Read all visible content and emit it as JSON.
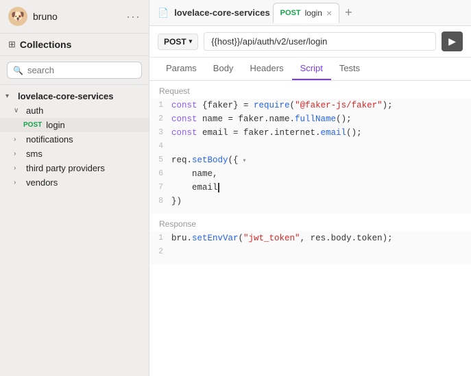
{
  "app": {
    "name": "bruno",
    "icon": "🐶",
    "more_label": "···"
  },
  "sidebar": {
    "collections_label": "Collections",
    "search_placeholder": "search",
    "tree": [
      {
        "id": "lovelace-core-services",
        "label": "lovelace-core-services",
        "level": 0,
        "chevron": "▾",
        "type": "root"
      },
      {
        "id": "auth",
        "label": "auth",
        "level": 1,
        "chevron": "∨",
        "type": "folder"
      },
      {
        "id": "post-login",
        "label": "login",
        "level": 2,
        "method": "POST",
        "type": "request",
        "active": true
      },
      {
        "id": "notifications",
        "label": "notifications",
        "level": 1,
        "chevron": "›",
        "type": "folder"
      },
      {
        "id": "sms",
        "label": "sms",
        "level": 1,
        "chevron": "›",
        "type": "folder"
      },
      {
        "id": "third-party-providers",
        "label": "third party providers",
        "level": 1,
        "chevron": "›",
        "type": "folder"
      },
      {
        "id": "vendors",
        "label": "vendors",
        "level": 1,
        "chevron": "›",
        "type": "folder"
      }
    ]
  },
  "main": {
    "window_title": "lovelace-core-services",
    "tab": {
      "method": "POST",
      "name": "login",
      "close": "×"
    },
    "add_tab": "+",
    "url": {
      "method": "POST",
      "template": "{{host}}",
      "path": "/api/auth/v2/user/login",
      "send_icon": "▶"
    },
    "nav_tabs": [
      "Params",
      "Body",
      "Headers",
      "Script",
      "Tests"
    ],
    "active_nav_tab": "Script",
    "request_label": "Request",
    "response_label": "Response",
    "request_code": [
      {
        "line": 1,
        "tokens": [
          {
            "t": "kw",
            "v": "const"
          },
          {
            "t": "var",
            "v": " {faker} = "
          },
          {
            "t": "fn",
            "v": "require"
          },
          {
            "t": "var",
            "v": "("
          },
          {
            "t": "str",
            "v": "\"@faker-js/faker\""
          },
          {
            "t": "var",
            "v": ");"
          }
        ]
      },
      {
        "line": 2,
        "tokens": [
          {
            "t": "kw",
            "v": "const"
          },
          {
            "t": "var",
            "v": " name = faker.name."
          },
          {
            "t": "fn",
            "v": "fullName"
          },
          {
            "t": "var",
            "v": "();"
          }
        ]
      },
      {
        "line": 3,
        "tokens": [
          {
            "t": "kw",
            "v": "const"
          },
          {
            "t": "var",
            "v": " email = faker.internet."
          },
          {
            "t": "fn",
            "v": "email"
          },
          {
            "t": "var",
            "v": "();"
          }
        ]
      },
      {
        "line": 4,
        "tokens": []
      },
      {
        "line": 5,
        "tokens": [
          {
            "t": "var",
            "v": "req."
          },
          {
            "t": "fn",
            "v": "setBody"
          },
          {
            "t": "var",
            "v": "({"
          },
          {
            "t": "tri",
            "v": "▾"
          }
        ]
      },
      {
        "line": 6,
        "tokens": [
          {
            "t": "var",
            "v": "    name,"
          }
        ]
      },
      {
        "line": 7,
        "tokens": [
          {
            "t": "var",
            "v": "    email"
          }
        ],
        "cursor": true
      },
      {
        "line": 8,
        "tokens": [
          {
            "t": "var",
            "v": "})"
          }
        ]
      }
    ],
    "response_code": [
      {
        "line": 1,
        "tokens": [
          {
            "t": "var",
            "v": "bru."
          },
          {
            "t": "fn",
            "v": "setEnvVar"
          },
          {
            "t": "var",
            "v": "("
          },
          {
            "t": "str",
            "v": "\"jwt_token\""
          },
          {
            "t": "var",
            "v": ", res.body.token);"
          }
        ]
      },
      {
        "line": 2,
        "tokens": []
      }
    ]
  }
}
